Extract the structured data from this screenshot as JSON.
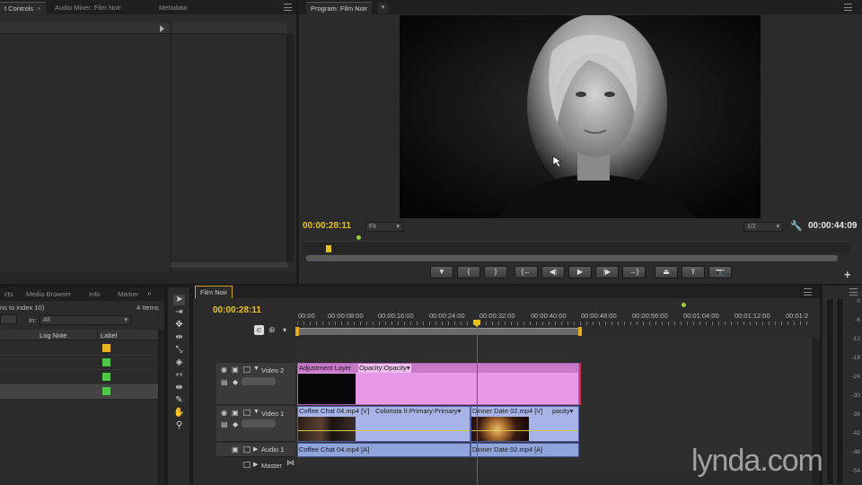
{
  "source_monitor": {
    "tabs": [
      {
        "label": "t Controls",
        "close": "×"
      },
      {
        "label": "Audio Mixer: Film Noir"
      },
      {
        "label": "Metadata"
      }
    ]
  },
  "program_monitor": {
    "tab": "Program: Film Noir",
    "current_time": "00:00:28:11",
    "fit": "Fit",
    "resolution": "1/2",
    "duration": "00:00:44:09",
    "transport": [
      "▼",
      "{",
      "}",
      "{←",
      "◀|",
      "▶",
      "|▶",
      "→}"
    ]
  },
  "project_panel": {
    "tabs": [
      "cts",
      "Media Browser",
      "Info",
      "Marker"
    ],
    "status": "ns to index 10)",
    "item_count": "4 Items",
    "in_label": "In:",
    "in_value": "All",
    "columns": [
      "Log Note",
      "Label"
    ],
    "label_colors": [
      "#e6b422",
      "#4fc64a",
      "#4fc64a",
      "#4fc64a"
    ]
  },
  "timeline": {
    "tab": "Film Noir",
    "current_time": "00:00:28:11",
    "ruler": [
      "00:00",
      "00:00:08:00",
      "00:00:16:00",
      "00:00:24:00",
      "00:00:32:00",
      "00:00:40:00",
      "00:00:48:00",
      "00:00:56:00",
      "00:01:04:00",
      "00:01:12:00",
      "00:01:2"
    ],
    "tracks": {
      "video2": "Video 2",
      "video1": "Video 1",
      "audio1": "Audio 1",
      "master": "Master"
    },
    "clips": {
      "adjustment": "Adjustment Layer",
      "adjustment_fx": "Opacity:Opacity▾",
      "coffee_v": "Coffee Chat 04.mp4 [V]",
      "colorista": "Colorista II:Primary:Primary▾",
      "dinner_v": "Dinner Date 02.mp4 [V]",
      "opacity": "pacity▾",
      "coffee_a": "Coffee Chat 04.mp4 [A]",
      "dinner_a": "Dinner Date 02.mp4 [A]"
    }
  },
  "meter": {
    "labels": [
      "0",
      "-6",
      "-12",
      "-18",
      "-24",
      "-30",
      "-36",
      "-42",
      "-48",
      "-54"
    ]
  },
  "watermark": "lynda.com",
  "colors": {
    "timecode": "#e8c21a",
    "adjustment_clip": "#e89ae8",
    "video_clip": "#a8b4e8",
    "audio_clip": "#8fa4d8",
    "playhead": "#c23a3a"
  }
}
